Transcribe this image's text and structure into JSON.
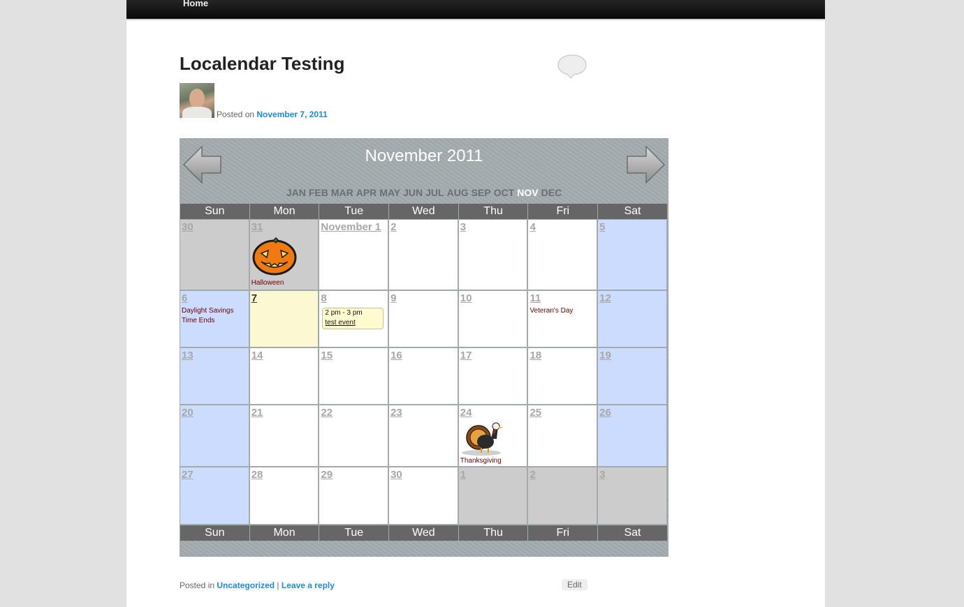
{
  "nav": {
    "home_label": "Home"
  },
  "post": {
    "title": "Localendar Testing",
    "posted_on_prefix": "Posted on",
    "date": "November 7, 2011"
  },
  "calendar": {
    "title": "November 2011",
    "months": [
      "JAN",
      "FEB",
      "MAR",
      "APR",
      "MAY",
      "JUN",
      "JUL",
      "AUG",
      "SEP",
      "OCT",
      "NOV",
      "DEC"
    ],
    "active_month": "NOV",
    "weekdays": [
      "Sun",
      "Mon",
      "Tue",
      "Wed",
      "Thu",
      "Fri",
      "Sat"
    ],
    "weeks": [
      [
        {
          "n": "30",
          "t": "other"
        },
        {
          "n": "31",
          "t": "other"
        },
        {
          "n": "November 1",
          "t": "day"
        },
        {
          "n": "2",
          "t": "day"
        },
        {
          "n": "3",
          "t": "day"
        },
        {
          "n": "4",
          "t": "day"
        },
        {
          "n": "5",
          "t": "weekend"
        }
      ],
      [
        {
          "n": "6",
          "t": "weekend"
        },
        {
          "n": "7",
          "t": "today"
        },
        {
          "n": "8",
          "t": "day"
        },
        {
          "n": "9",
          "t": "day"
        },
        {
          "n": "10",
          "t": "day"
        },
        {
          "n": "11",
          "t": "day"
        },
        {
          "n": "12",
          "t": "weekend"
        }
      ],
      [
        {
          "n": "13",
          "t": "weekend"
        },
        {
          "n": "14",
          "t": "day"
        },
        {
          "n": "15",
          "t": "day"
        },
        {
          "n": "16",
          "t": "day"
        },
        {
          "n": "17",
          "t": "day"
        },
        {
          "n": "18",
          "t": "day"
        },
        {
          "n": "19",
          "t": "weekend"
        }
      ],
      [
        {
          "n": "20",
          "t": "weekend"
        },
        {
          "n": "21",
          "t": "day"
        },
        {
          "n": "22",
          "t": "day"
        },
        {
          "n": "23",
          "t": "day"
        },
        {
          "n": "24",
          "t": "day"
        },
        {
          "n": "25",
          "t": "day"
        },
        {
          "n": "26",
          "t": "weekend"
        }
      ],
      [
        {
          "n": "27",
          "t": "weekend"
        },
        {
          "n": "28",
          "t": "day"
        },
        {
          "n": "29",
          "t": "day"
        },
        {
          "n": "30",
          "t": "day"
        },
        {
          "n": "1",
          "t": "other"
        },
        {
          "n": "2",
          "t": "other"
        },
        {
          "n": "3",
          "t": "other"
        }
      ]
    ],
    "events": {
      "halloween": "Halloween",
      "dst_line1": "Daylight Savings",
      "dst_line2": "Time Ends",
      "veterans": "Veteran's Day",
      "thanksgiving": "Thanksgiving",
      "test_time": "2 pm - 3 pm",
      "test_title": "test event"
    },
    "icons": {
      "prev": "left-arrow-icon",
      "next": "right-arrow-icon",
      "halloween": "pumpkin-icon",
      "thanksgiving": "turkey-icon"
    }
  },
  "footer": {
    "posted_in_prefix": "Posted in",
    "category": "Uncategorized",
    "separator": "|",
    "reply": "Leave a reply",
    "edit": "Edit"
  }
}
